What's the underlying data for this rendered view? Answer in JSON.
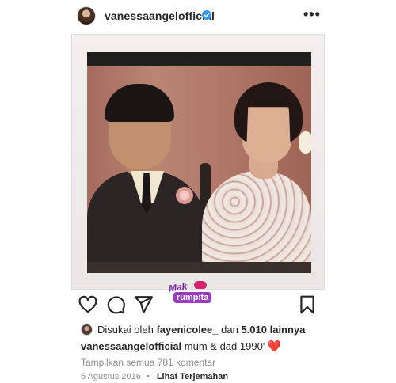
{
  "post": {
    "username": "vanessaangelofficial",
    "verified": true,
    "more_icon": "more-horizontal-icon"
  },
  "image": {
    "watermark_top": "Mak",
    "watermark_bottom": "rumpita"
  },
  "actions": {
    "like_icon": "heart-icon",
    "comment_icon": "comment-icon",
    "share_icon": "send-icon",
    "save_icon": "bookmark-icon"
  },
  "likes": {
    "prefix": "Disukai oleh",
    "liker": "fayenicolee_",
    "connector": "dan",
    "others": "5.010 lainnya"
  },
  "caption": {
    "username": "vanessaangelofficial",
    "text": "mum & dad 1990'",
    "emoji": "❤️"
  },
  "comments_link": "Tampilkan semua 781 komentar",
  "meta": {
    "date": "6 Agustus 2016",
    "separator": "•",
    "translate": "Lihat Terjemahan"
  },
  "colors": {
    "text": "#262626",
    "muted": "#8e8e8e",
    "verified_blue": "#3897f0",
    "heart_red": "#e0213c"
  }
}
